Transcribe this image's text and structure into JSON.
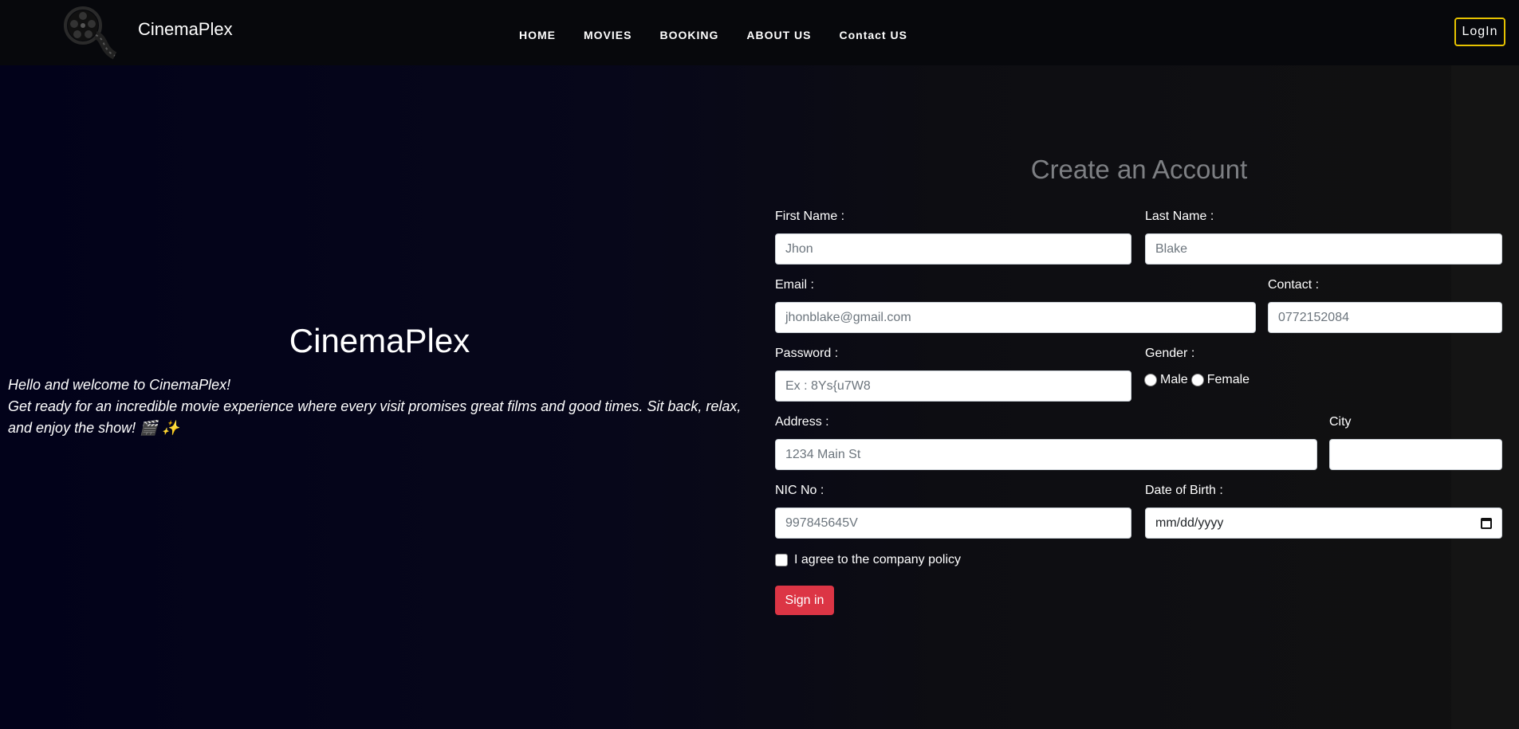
{
  "navbar": {
    "brand": "CinemaPlex",
    "links": [
      "HOME",
      "MOVIES",
      "BOOKING",
      "ABOUT US",
      "Contact US"
    ],
    "login_label": "LogIn"
  },
  "hero": {
    "title": "CinemaPlex",
    "line1": "Hello and welcome to CinemaPlex!",
    "line2": "Get ready for an incredible movie experience where every visit promises great films and good times. Sit back, relax, and enjoy the show! 🎬 ✨"
  },
  "form": {
    "title": "Create an Account",
    "first_name": {
      "label": "First Name :",
      "placeholder": "Jhon"
    },
    "last_name": {
      "label": "Last Name :",
      "placeholder": "Blake"
    },
    "email": {
      "label": "Email :",
      "placeholder": "jhonblake@gmail.com"
    },
    "contact": {
      "label": "Contact :",
      "placeholder": "0772152084"
    },
    "password": {
      "label": "Password :",
      "placeholder": "Ex : 8Ys{u7W8"
    },
    "gender": {
      "label": "Gender :",
      "options": [
        "Male",
        "Female"
      ]
    },
    "address": {
      "label": "Address :",
      "placeholder": "1234 Main St"
    },
    "city": {
      "label": "City",
      "placeholder": ""
    },
    "nic": {
      "label": "NIC No :",
      "placeholder": "997845645V"
    },
    "dob": {
      "label": "Date of Birth :",
      "placeholder": "mm/dd/yyyy"
    },
    "agree_label": "I agree to the company policy",
    "submit_label": "Sign in"
  },
  "colors": {
    "accent": "#dc3545",
    "login_border": "#e6c200",
    "title_gray": "#7d7f83"
  }
}
